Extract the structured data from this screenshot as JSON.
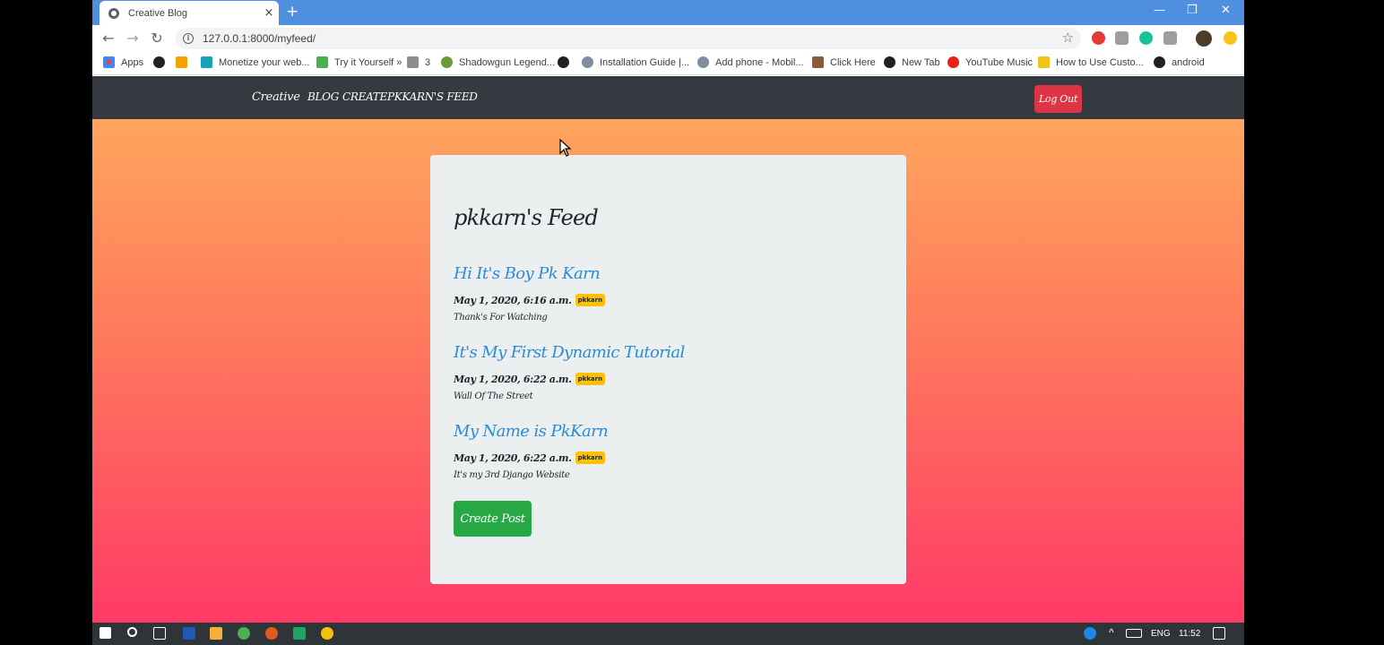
{
  "browser": {
    "tab_title": "Creative Blog",
    "tab_close": "×",
    "new_tab": "+",
    "url": "127.0.0.1:8000/myfeed/",
    "window_controls": [
      "—",
      "❐",
      "✕"
    ],
    "bookmarks": [
      {
        "label": "Apps",
        "color": "#e94235"
      },
      {
        "label": "",
        "color": "#202124"
      },
      {
        "label": "",
        "color": "#f4a300"
      },
      {
        "label": "Monetize your web...",
        "color": "#17a2b8"
      },
      {
        "label": "Try it Yourself »",
        "color": "#4caf50"
      },
      {
        "label": "3",
        "color": "#8d8d8d"
      },
      {
        "label": "Shadowgun Legend...",
        "color": "#6a9a3a"
      },
      {
        "label": "",
        "color": "#202124"
      },
      {
        "label": "Installation Guide |...",
        "color": "#7e8ea0"
      },
      {
        "label": "Add phone - Mobil...",
        "color": "#7e8ea0"
      },
      {
        "label": "Click Here",
        "color": "#8b5a3c"
      },
      {
        "label": "New Tab",
        "color": "#202124"
      },
      {
        "label": "YouTube Music",
        "color": "#e62117"
      },
      {
        "label": "How to Use Custo...",
        "color": "#f0c419"
      },
      {
        "label": "android",
        "color": "#202124"
      }
    ]
  },
  "navbar": {
    "brand": "Creative",
    "links": [
      "BLOG",
      "CREATE",
      "PKKARN'S FEED"
    ],
    "logout": "Log Out"
  },
  "feed": {
    "title": "pkkarn's Feed",
    "posts": [
      {
        "title": "Hi It's Boy Pk Karn",
        "date": "May 1, 2020, 6:16 a.m.",
        "author": "pkkarn",
        "body": "Thank's For Watching"
      },
      {
        "title": "It's My First Dynamic Tutorial",
        "date": "May 1, 2020, 6:22 a.m.",
        "author": "pkkarn",
        "body": "Wall Of The Street"
      },
      {
        "title": "My Name is PkKarn",
        "date": "May 1, 2020, 6:22 a.m.",
        "author": "pkkarn",
        "body": "It's my 3rd Django Website"
      }
    ],
    "create_button": "Create Post"
  },
  "taskbar": {
    "lang": "ENG",
    "time": "11:52"
  },
  "colors": {
    "accent_blue": "#2a8bd6",
    "logout_red": "#dc3545",
    "create_green": "#28a745",
    "badge_yellow": "#ffc107",
    "navbar_dark": "#343a40"
  }
}
